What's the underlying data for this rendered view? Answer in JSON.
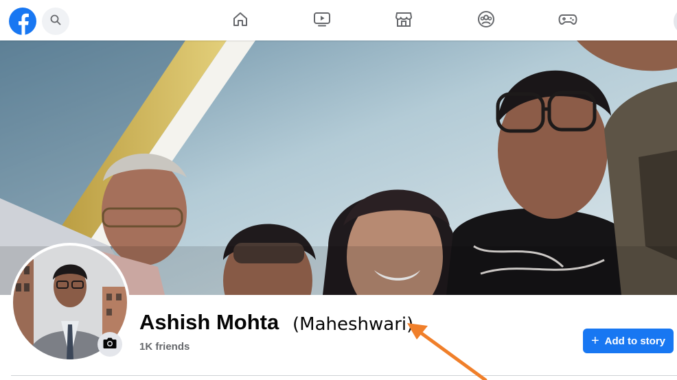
{
  "topbar": {
    "logo_icon": "facebook-logo",
    "search_icon": "search-icon",
    "nav_items": [
      {
        "icon": "home-icon"
      },
      {
        "icon": "video-icon"
      },
      {
        "icon": "marketplace-icon"
      },
      {
        "icon": "groups-icon"
      },
      {
        "icon": "gaming-icon"
      }
    ]
  },
  "profile": {
    "name": "Ashish Mohta",
    "alternate_name": "(Maheshwari)",
    "friends": "1K friends",
    "add_story_label": "Add to story"
  },
  "colors": {
    "brand_blue": "#1877f2",
    "annotation_arrow": "#f07f2a",
    "secondary_text": "#65676b"
  }
}
